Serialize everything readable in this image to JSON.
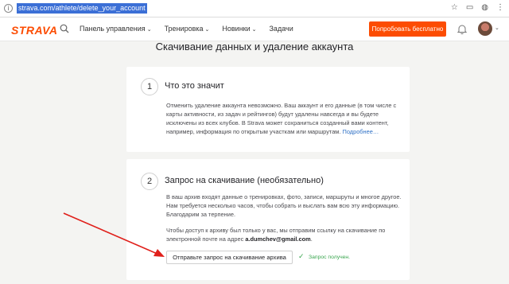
{
  "browser": {
    "url": "strava.com/athlete/delete_your_account",
    "icons": [
      "star-icon",
      "bookmark-icon",
      "extension-icon",
      "menu-icon"
    ]
  },
  "header": {
    "logo": "STRAVA",
    "nav": [
      {
        "label": "Панель управления",
        "dropdown": true
      },
      {
        "label": "Тренировка",
        "dropdown": true
      },
      {
        "label": "Новинки",
        "dropdown": true
      },
      {
        "label": "Задачи",
        "dropdown": false
      }
    ],
    "cta": "Попробовать бесплатно",
    "accent_color": "#fc4c02"
  },
  "page": {
    "title": "Скачивание данных и удаление аккаунта"
  },
  "cards": [
    {
      "number": "1",
      "title": "Что это значит",
      "text": "Отменить удаление аккаунта невозможно. Ваш аккаунт и его данные (в том числе с карты активности, из задач и рейтингов) будут удалены навсегда и вы будете исключены из всех клубов. В Strava может сохраниться созданный вами контент, например, информация по открытым участкам или маршрутам.",
      "more_link": "Подробнее…"
    },
    {
      "number": "2",
      "title": "Запрос на скачивание (необязательно)",
      "text1": "В ваш архив входят данные о тренировках, фото, записи, маршруты и многое другое. Нам требуется несколько часов, чтобы собрать и выслать вам всю эту информацию. Благодарим за терпение.",
      "text2_prefix": "Чтобы доступ к архиву был только у вас, мы отправим ссылку на скачивание по электронной почте на адрес ",
      "email": "a.dumchev@gmail.com",
      "text2_suffix": ".",
      "button": "Отправьте запрос на скачивание архива",
      "status": "Запрос получен.",
      "status_color": "#3aa64f"
    }
  ],
  "annotation": {
    "arrow_color": "#e0201b"
  }
}
